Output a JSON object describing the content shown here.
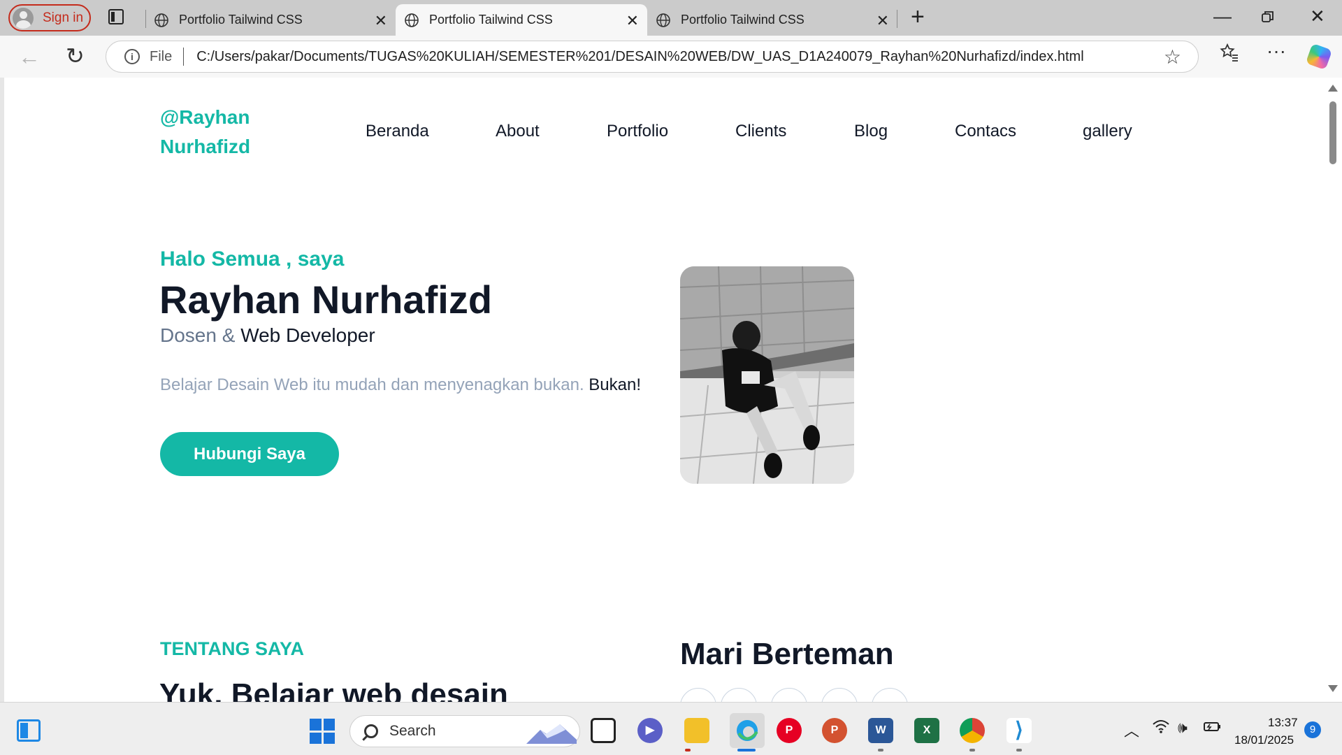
{
  "browser": {
    "signin_label": "Sign in",
    "tabs": [
      {
        "title": "Portfolio Tailwind CSS"
      },
      {
        "title": "Portfolio Tailwind CSS"
      },
      {
        "title": "Portfolio Tailwind CSS"
      }
    ],
    "close_glyph": "✕",
    "new_tab_glyph": "+",
    "address": {
      "scheme_label": "File",
      "url": "C:/Users/pakar/Documents/TUGAS%20KULIAH/SEMESTER%201/DESAIN%20WEB/DW_UAS_D1A240079_Rayhan%20Nurhafizd/index.html"
    },
    "icons": [
      "back-arrow-icon",
      "reload-icon",
      "info-icon",
      "favorite-star-icon",
      "favorites-icon",
      "more-icon",
      "copilot-icon"
    ]
  },
  "page": {
    "brand": {
      "line1": "@Rayhan",
      "line2": "Nurhafizd"
    },
    "nav": [
      "Beranda",
      "About",
      "Portfolio",
      "Clients",
      "Blog",
      "Contacs",
      "gallery"
    ],
    "hero": {
      "greeting": "Halo Semua , saya",
      "name": "Rayhan Nurhafizd",
      "role_part1": "Dosen &",
      "role_part2": "Web Developer",
      "tagline_part1": "Belajar Desain Web itu mudah dan menyenagkan bukan.",
      "tagline_part2": "Bukan!",
      "cta": "Hubungi Saya"
    },
    "about": {
      "label": "TENTANG SAYA",
      "title": "Yuk, Belajar web desain"
    },
    "friends": {
      "title": "Mari Berteman"
    },
    "colors": {
      "accent": "#14b8a6",
      "heading": "#111827",
      "muted": "#94a3b8"
    }
  },
  "taskbar": {
    "search_label": "Search",
    "apps": [
      "task-view",
      "zoom",
      "file-explorer",
      "edge",
      "pinterest",
      "powerpoint",
      "word",
      "excel",
      "chrome",
      "vscode"
    ],
    "time": "13:37",
    "date": "18/01/2025",
    "notifications": "9"
  }
}
